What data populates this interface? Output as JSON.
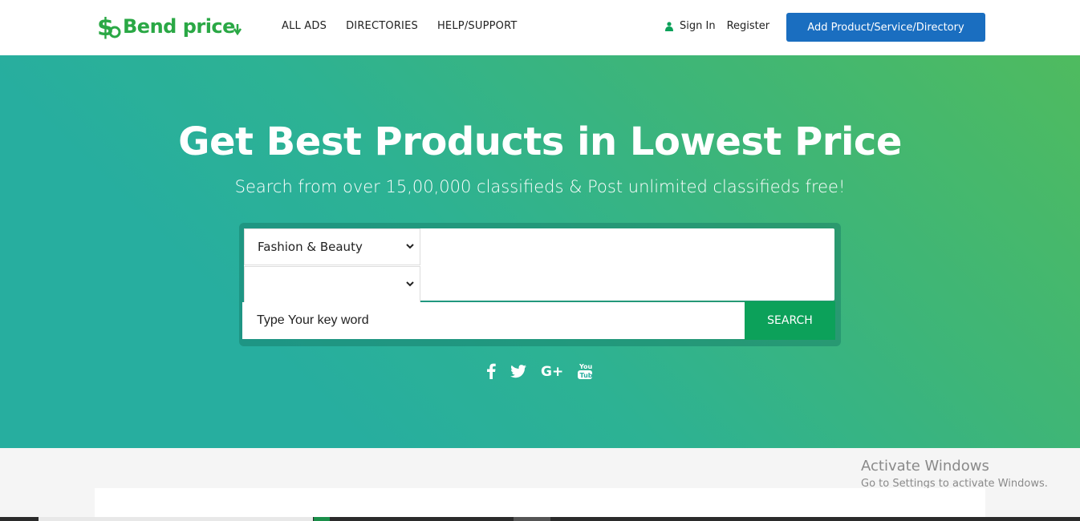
{
  "brand": {
    "name": "Bend price",
    "logo_icon": "dollar-sign-icon"
  },
  "nav": {
    "items": [
      "ALL ADS",
      "DIRECTORIES",
      "HELP/SUPPORT"
    ]
  },
  "user": {
    "sign_in": "Sign In",
    "register": "Register",
    "icon": "user-icon"
  },
  "header": {
    "add_button": "Add Product/Service/Directory"
  },
  "hero": {
    "title": "Get Best Products in Lowest Price",
    "subtitle": "Search from over 15,00,000 classifieds & Post unlimited classifieds free!"
  },
  "search": {
    "category_selected": "Fashion & Beauty",
    "subcategory_selected": "",
    "placeholder": "Type Your key word",
    "button": "SEARCH"
  },
  "social": [
    "facebook-icon",
    "twitter-icon",
    "google-plus-icon",
    "youtube-icon"
  ],
  "watermark": {
    "title": "Activate Windows",
    "subtitle": "Go to Settings to activate Windows."
  },
  "colors": {
    "brand_green": "#2aa845",
    "primary_blue": "#1a6ec0",
    "search_green": "#0ca15a"
  }
}
